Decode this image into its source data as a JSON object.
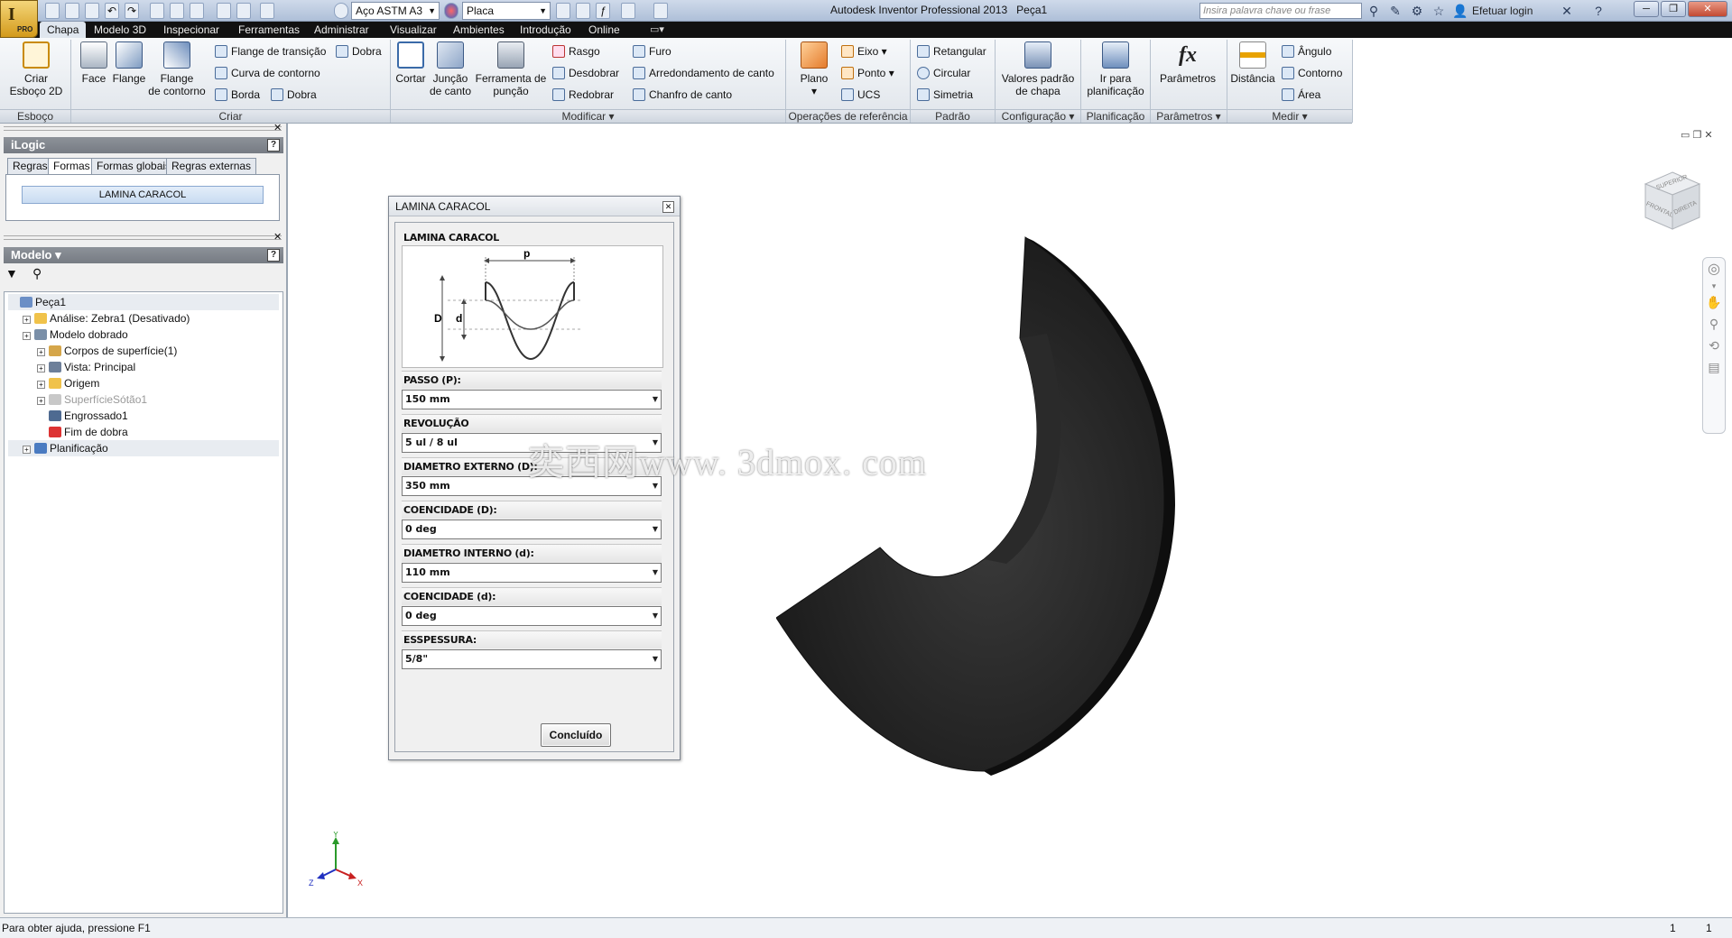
{
  "app": {
    "title": "Autodesk Inventor Professional 2013",
    "document": "Peça1",
    "badge": "PRO",
    "material": "Aço ASTM A3",
    "appearance": "Placa",
    "search_placeholder": "Insira palavra chave ou frase",
    "login": "Efetuar login"
  },
  "menu_tabs": [
    "Chapa",
    "Modelo 3D",
    "Inspecionar",
    "Ferramentas",
    "Administrar",
    "Visualizar",
    "Ambientes",
    "Introdução",
    "Online"
  ],
  "ribbon": {
    "esboco": {
      "label": "Esboço",
      "criar_esboco": "Criar\nEsboço 2D"
    },
    "criar": {
      "label": "Criar",
      "face": "Face",
      "flange": "Flange",
      "flange_contorno": "Flange\nde contorno",
      "flange_transicao": "Flange de transição",
      "curva_contorno": "Curva de contorno",
      "borda": "Borda",
      "dobra1": "Dobra",
      "dobra2": "Dobra"
    },
    "modificar": {
      "label": "Modificar",
      "cortar": "Cortar",
      "juncao": "Junção\nde canto",
      "ferramenta": "Ferramenta de\npunção",
      "rasgo": "Rasgo",
      "desdobrar": "Desdobrar",
      "redobrar": "Redobrar",
      "furo": "Furo",
      "arredondamento": "Arredondamento de canto",
      "chanfro": "Chanfro de canto"
    },
    "referencia": {
      "label": "Operações de referência",
      "plano": "Plano",
      "eixo": "Eixo",
      "ponto": "Ponto",
      "ucs": "UCS"
    },
    "padrao": {
      "label": "Padrão",
      "retangular": "Retangular",
      "circular": "Circular",
      "simetria": "Simetria"
    },
    "configuracao": {
      "label": "Configuração",
      "valores": "Valores padrão\nde chapa"
    },
    "planificacao": {
      "label": "Planificação",
      "ir": "Ir para\nplanificação"
    },
    "parametros": {
      "label": "Parâmetros",
      "parametros": "Parâmetros"
    },
    "medir": {
      "label": "Medir",
      "distancia": "Distância",
      "angulo": "Ângulo",
      "contorno": "Contorno",
      "area": "Área"
    }
  },
  "ilogic": {
    "title": "iLogic",
    "tabs": [
      "Regras",
      "Formas",
      "Formas globais",
      "Regras externas"
    ],
    "form_button": "LAMINA CARACOL"
  },
  "model": {
    "title": "Modelo",
    "tree": [
      {
        "label": "Peça1",
        "level": 0
      },
      {
        "label": "Análise: Zebra1 (Desativado)",
        "level": 1
      },
      {
        "label": "Modelo dobrado",
        "level": 1
      },
      {
        "label": "Corpos de superfície(1)",
        "level": 2
      },
      {
        "label": "Vista: Principal",
        "level": 2
      },
      {
        "label": "Origem",
        "level": 2
      },
      {
        "label": "SuperfícieSótão1",
        "level": 2
      },
      {
        "label": "Engrossado1",
        "level": 2
      },
      {
        "label": "Fim de dobra",
        "level": 2
      },
      {
        "label": "Planificação",
        "level": 1
      }
    ]
  },
  "dialog": {
    "title": "LAMINA CARACOL",
    "section": "LAMINA CARACOL",
    "diagram": {
      "p": "p",
      "D": "D",
      "d": "d"
    },
    "fields": [
      {
        "label": "PASSO (P):",
        "value": "150 mm"
      },
      {
        "label": "REVOLUÇÃO",
        "value": "5 ul / 8 ul"
      },
      {
        "label": "DIAMETRO EXTERNO (D):",
        "value": "350 mm"
      },
      {
        "label": "COENCIDADE (D):",
        "value": "0 deg"
      },
      {
        "label": "DIAMETRO INTERNO (d):",
        "value": "110 mm"
      },
      {
        "label": "COENCIDADE (d):",
        "value": "0 deg"
      },
      {
        "label": "ESSPESSURA:",
        "value": "5/8\""
      }
    ],
    "done": "Concluído"
  },
  "viewcube": {
    "front": "FRONTAL",
    "right": "DIREITA",
    "top": "SUPERIOR"
  },
  "axes": {
    "x": "X",
    "y": "Y",
    "z": "Z"
  },
  "watermark": "奕西网www. 3dmox. com",
  "status": {
    "help": "Para obter ajuda, pressione F1",
    "n1": "1",
    "n2": "1"
  }
}
